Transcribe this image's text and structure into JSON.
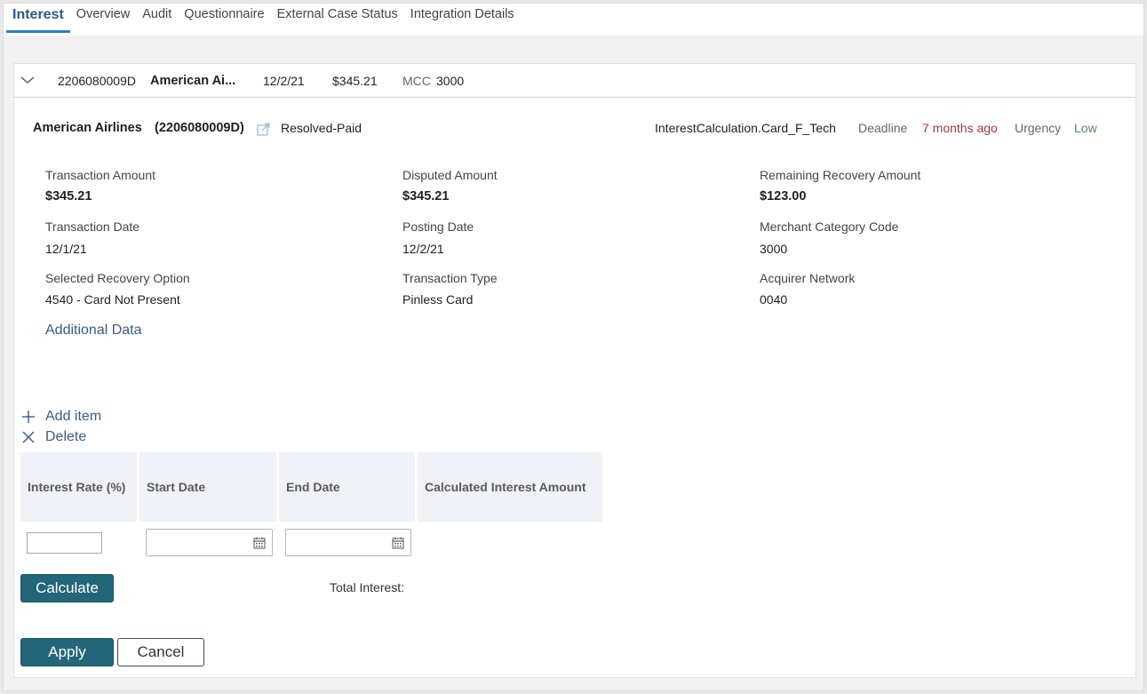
{
  "tabs": [
    {
      "label": "Interest",
      "active": true
    },
    {
      "label": "Overview"
    },
    {
      "label": "Audit"
    },
    {
      "label": "Questionnaire"
    },
    {
      "label": "External Case Status"
    },
    {
      "label": "Integration Details"
    }
  ],
  "summary": {
    "case_id": "2206080009D",
    "merchant": "American Ai...",
    "date": "12/2/21",
    "amount": "$345.21",
    "mcc_label": "MCC",
    "mcc_value": "3000"
  },
  "case_header": {
    "title": "American Airlines",
    "case_ref": "(2206080009D)",
    "status": "Resolved-Paid",
    "workflow": "InterestCalculation.Card_F_Tech",
    "deadline_label": "Deadline",
    "deadline_value": "7 months ago",
    "urgency_label": "Urgency",
    "urgency_value": "Low"
  },
  "fields": {
    "transaction_amount": {
      "label": "Transaction Amount",
      "value": "$345.21"
    },
    "disputed_amount": {
      "label": "Disputed Amount",
      "value": "$345.21"
    },
    "remaining_recovery": {
      "label": "Remaining Recovery Amount",
      "value": "$123.00"
    },
    "transaction_date": {
      "label": "Transaction Date",
      "value": "12/1/21"
    },
    "posting_date": {
      "label": "Posting Date",
      "value": "12/2/21"
    },
    "mcc": {
      "label": "Merchant Category Code",
      "value": "3000"
    },
    "recovery_option": {
      "label": "Selected Recovery Option",
      "value": "4540 - Card Not Present"
    },
    "transaction_type": {
      "label": "Transaction Type",
      "value": "Pinless Card"
    },
    "acquirer_network": {
      "label": "Acquirer Network",
      "value": "0040"
    }
  },
  "additional_data_label": "Additional Data",
  "actions": {
    "add_item": "Add item",
    "delete": "Delete"
  },
  "grid": {
    "columns": [
      "Interest Rate (%)",
      "Start Date",
      "End Date",
      "Calculated Interest Amount"
    ],
    "row": {
      "interest_rate": "",
      "start_date": "",
      "end_date": ""
    }
  },
  "calculate_label": "Calculate",
  "total_interest_label": "Total Interest:",
  "apply_label": "Apply",
  "cancel_label": "Cancel",
  "colors": {
    "accent": "#23667a",
    "tab_active": "#2d5a86",
    "deadline": "#a33a3a",
    "urgency_low": "#4f8a55"
  },
  "icons": [
    "chevron-down-icon",
    "external-link-icon",
    "plus-icon",
    "close-icon",
    "calendar-icon"
  ]
}
